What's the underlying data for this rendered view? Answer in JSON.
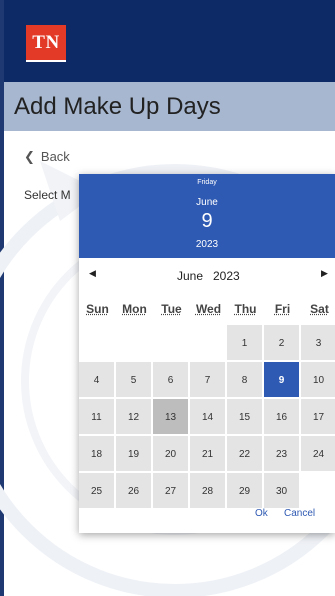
{
  "header": {
    "logo_text": "TN"
  },
  "title_bar": {
    "title": "Add Make Up Days"
  },
  "back_link": {
    "label": "Back"
  },
  "form": {
    "select_label": "Select M"
  },
  "datepicker": {
    "selected_weekday": "Friday",
    "selected_month": "June",
    "selected_day": "9",
    "selected_year": "2023",
    "nav_month": "June",
    "nav_year": "2023",
    "weekdays": [
      "Sun",
      "Mon",
      "Tue",
      "Wed",
      "Thu",
      "Fri",
      "Sat"
    ],
    "weeks": [
      [
        "",
        "",
        "",
        "",
        "1",
        "2",
        "3"
      ],
      [
        "4",
        "5",
        "6",
        "7",
        "8",
        "9",
        "10"
      ],
      [
        "11",
        "12",
        "13",
        "14",
        "15",
        "16",
        "17"
      ],
      [
        "18",
        "19",
        "20",
        "21",
        "22",
        "23",
        "24"
      ],
      [
        "25",
        "26",
        "27",
        "28",
        "29",
        "30",
        ""
      ]
    ],
    "selected_date": "9",
    "today_date": "13",
    "ok_label": "Ok",
    "cancel_label": "Cancel"
  },
  "colors": {
    "header_bg": "#0e2a66",
    "title_bar_bg": "#a7b7cf",
    "logo_bg": "#e23a26",
    "accent": "#2f5ab3"
  }
}
